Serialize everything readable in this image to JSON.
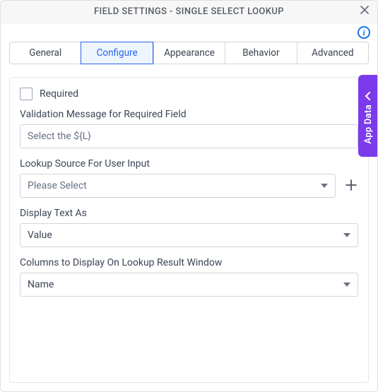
{
  "header": {
    "title": "FIELD SETTINGS - SINGLE SELECT LOOKUP"
  },
  "tabs": {
    "general": "General",
    "configure": "Configure",
    "appearance": "Appearance",
    "behavior": "Behavior",
    "advanced": "Advanced",
    "active": "configure"
  },
  "side_panel": {
    "label": "App Data"
  },
  "form": {
    "required_label": "Required",
    "required_checked": false,
    "validation_label": "Validation Message for Required Field",
    "validation_value": "Select the ${L}",
    "lookup_source_label": "Lookup Source For User Input",
    "lookup_source_value": "Please Select",
    "display_text_label": "Display Text As",
    "display_text_value": "Value",
    "columns_label": "Columns to Display On Lookup Result Window",
    "columns_value": "Name"
  }
}
